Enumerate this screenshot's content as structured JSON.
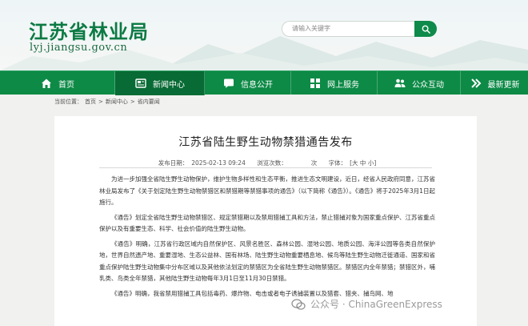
{
  "header": {
    "site_title": "江苏省林业局",
    "site_url": "lyj.jiangsu.gov.cn",
    "search_placeholder": "请输入关键字"
  },
  "nav": {
    "items": [
      {
        "label": "首页",
        "icon": "home-icon"
      },
      {
        "label": "新闻中心",
        "icon": "newspaper-icon"
      },
      {
        "label": "信息公开",
        "icon": "chat-icon"
      },
      {
        "label": "网上服务",
        "icon": "grid-icon"
      },
      {
        "label": "公众互动",
        "icon": "people-icon"
      },
      {
        "label": "最新更新",
        "icon": "arrow-icon"
      }
    ],
    "active_index": 1
  },
  "breadcrumb": {
    "prefix": "当前位置：",
    "items": [
      "首页",
      "新闻中心",
      "省内要闻"
    ],
    "separator": ">"
  },
  "article": {
    "title": "江苏省陆生野生动物禁猎通告发布",
    "date_label": "发布日期：",
    "date": "2025-02-13 09:24",
    "views_label": "浏览次数：",
    "views": "次",
    "font_label": "字体：",
    "font_sizes": "[大 中 小]",
    "paragraphs": [
      "为进一步加强全省陆生野生动物保护，维护生物多样性和生态平衡，推进生态文明建设，近日，经省人民政府同意，江苏省林业局发布了《关于划定陆生野生动物禁猎区和禁猎期等禁猎事项的通告》（以下简称《通告》）。《通告》将于2025年3月1日起施行。",
      "《通告》划定全省陆生野生动物禁猎区、规定禁猎期以及禁用猎捕工具和方法，禁止猎捕对象为国家重点保护、江苏省重点保护以及有重要生态、科学、社会价值的陆生野生动物。",
      "《通告》明确，江苏省行政区域内自然保护区、风景名胜区、森林公园、湿地公园、地质公园、海洋公园等各类自然保护地，世界自然遗产地、重要湿地、生态公益林、国有林场、陆生野生动物重要栖息地、候鸟等陆生野生动物迁徙通道、国家和省重点保护陆生野生动物集中分布区域以及其他依法划定的禁猎区为全省陆生野生动物禁猎区。禁猎区内全年禁猎；禁猎区外，哺乳类、鸟类全年禁猎，其他陆生野生动物每年3月1日至11月30日禁猎。",
      "《通告》明确，我省禁用猎捕工具包括毒药、爆炸物、电击或者电子诱捕装置以及猎套、猎夹、捕鸟网、地"
    ]
  },
  "watermark": {
    "text": "公众号 · ChinaGreenExpress"
  },
  "colors": {
    "brand_green": "#0d8a46",
    "active_nav": "#086a34",
    "title_green": "#0b7a43"
  }
}
